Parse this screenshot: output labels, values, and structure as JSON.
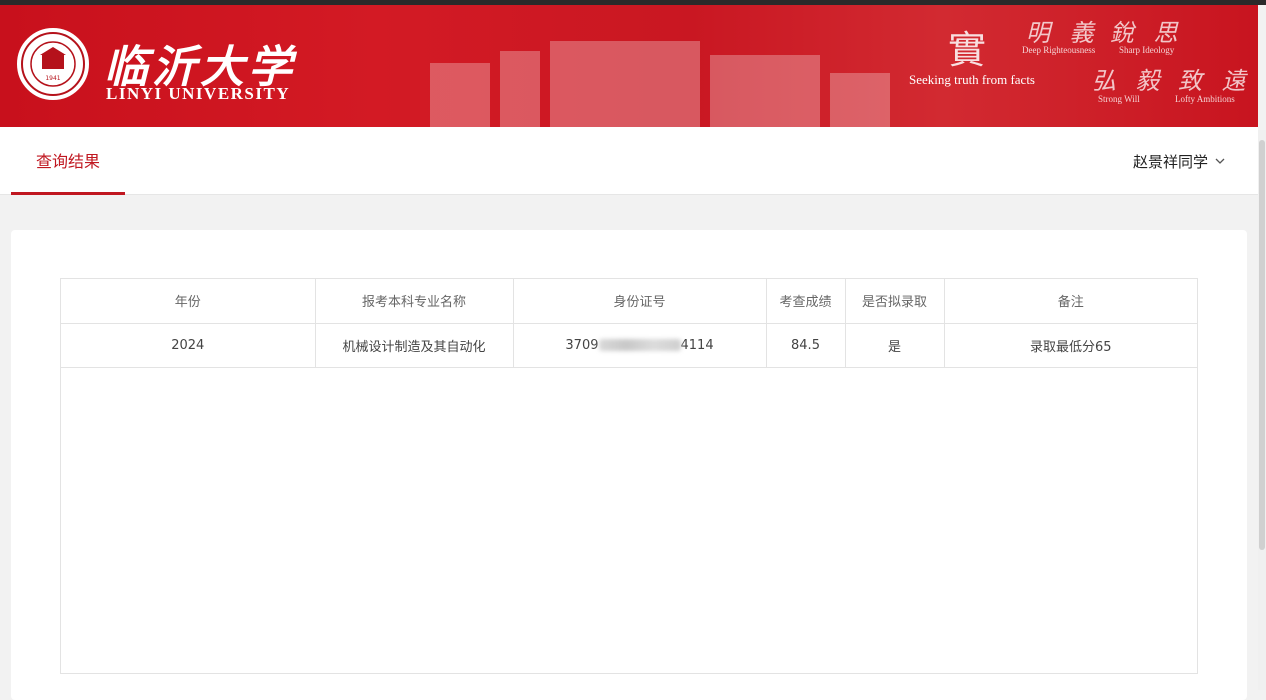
{
  "header": {
    "logo_cn": "临沂大学",
    "logo_en": "LINYI UNIVERSITY",
    "seal_year": "1941",
    "motto": {
      "shi": "實",
      "seeking": "Seeking truth from facts",
      "ming_yi": "明 義",
      "rui_si": "銳 思",
      "deep": "Deep Righteousness",
      "sharp": "Sharp Ideology",
      "hong_yi": "弘 毅",
      "zhi_yuan": "致 遠",
      "strong": "Strong Will",
      "lofty": "Lofty Ambitions"
    }
  },
  "nav": {
    "active_tab": "查询结果",
    "user": "赵景祥同学"
  },
  "table": {
    "headers": [
      "年份",
      "报考本科专业名称",
      "身份证号",
      "考查成绩",
      "是否拟录取",
      "备注"
    ],
    "rows": [
      {
        "year": "2024",
        "major": "机械设计制造及其自动化",
        "id_prefix": "3709",
        "id_suffix": "4114",
        "score": "84.5",
        "admitted": "是",
        "note": "录取最低分65"
      }
    ]
  },
  "colors": {
    "brand_red": "#c8101c",
    "accent": "#c01720"
  }
}
